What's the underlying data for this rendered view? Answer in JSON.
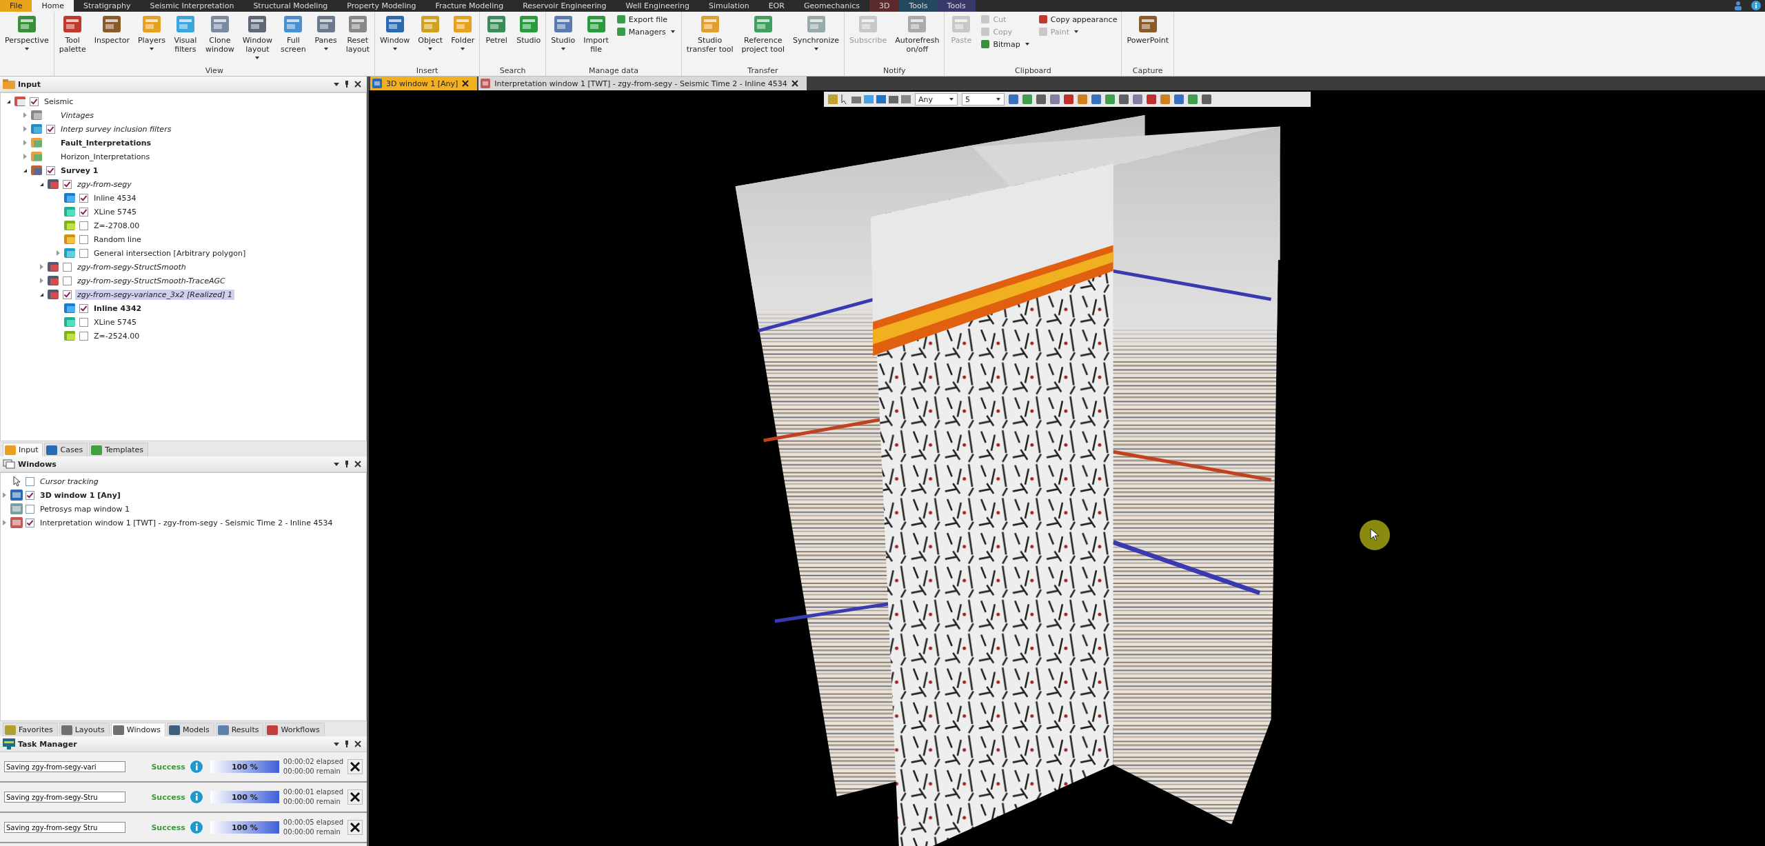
{
  "ribbon_tabs": [
    {
      "label": "File",
      "selected": false,
      "kind": "file"
    },
    {
      "label": "Home",
      "selected": true,
      "kind": "normal"
    },
    {
      "label": "Stratigraphy",
      "selected": false,
      "kind": "normal"
    },
    {
      "label": "Seismic Interpretation",
      "selected": false,
      "kind": "normal"
    },
    {
      "label": "Structural Modeling",
      "selected": false,
      "kind": "normal"
    },
    {
      "label": "Property Modeling",
      "selected": false,
      "kind": "normal"
    },
    {
      "label": "Fracture Modeling",
      "selected": false,
      "kind": "normal"
    },
    {
      "label": "Reservoir Engineering",
      "selected": false,
      "kind": "normal"
    },
    {
      "label": "Well Engineering",
      "selected": false,
      "kind": "normal"
    },
    {
      "label": "Simulation",
      "selected": false,
      "kind": "normal"
    },
    {
      "label": "EOR",
      "selected": false,
      "kind": "normal"
    },
    {
      "label": "Geomechanics",
      "selected": false,
      "kind": "normal"
    },
    {
      "label": "3D",
      "selected": false,
      "kind": "context",
      "color": "#5b2b2b"
    },
    {
      "label": "Tools",
      "selected": false,
      "kind": "context",
      "color": "#22495e"
    },
    {
      "label": "Tools",
      "selected": false,
      "kind": "context",
      "color": "#38386a"
    }
  ],
  "ribbon_groups": [
    {
      "items": [
        {
          "kind": "large",
          "label": "Perspective",
          "dropdown": true,
          "disabled": false
        }
      ]
    },
    {
      "label": "View",
      "items": [
        {
          "kind": "large",
          "label": "Tool\npalette",
          "dropdown": false,
          "disabled": false
        },
        {
          "kind": "large",
          "label": "Inspector",
          "dropdown": false,
          "disabled": false
        },
        {
          "kind": "large",
          "label": "Players",
          "dropdown": true,
          "disabled": false
        },
        {
          "kind": "large",
          "label": "Visual\nfilters",
          "dropdown": false,
          "disabled": false
        },
        {
          "kind": "large",
          "label": "Clone\nwindow",
          "dropdown": false,
          "disabled": false
        },
        {
          "kind": "large",
          "label": "Window\nlayout",
          "dropdown": true,
          "disabled": false
        },
        {
          "kind": "large",
          "label": "Full\nscreen",
          "dropdown": false,
          "disabled": false
        },
        {
          "kind": "large",
          "label": "Panes",
          "dropdown": true,
          "disabled": false
        },
        {
          "kind": "large",
          "label": "Reset\nlayout",
          "dropdown": false,
          "disabled": false
        }
      ]
    },
    {
      "label": "Insert",
      "items": [
        {
          "kind": "large",
          "label": "Window",
          "dropdown": true,
          "disabled": false
        },
        {
          "kind": "large",
          "label": "Object",
          "dropdown": true,
          "disabled": false
        },
        {
          "kind": "large",
          "label": "Folder",
          "dropdown": true,
          "disabled": false
        }
      ]
    },
    {
      "label": "Search",
      "items": [
        {
          "kind": "large",
          "label": "Petrel",
          "dropdown": false,
          "disabled": false
        },
        {
          "kind": "large",
          "label": "Studio",
          "dropdown": false,
          "disabled": false
        }
      ]
    },
    {
      "label": "Manage data",
      "items": [
        {
          "kind": "large",
          "label": "Studio",
          "dropdown": true,
          "disabled": false
        },
        {
          "kind": "large",
          "label": "Import\nfile",
          "dropdown": false,
          "disabled": false
        },
        {
          "kind": "stack",
          "items": [
            {
              "label": "Export file",
              "dropdown": false,
              "disabled": false
            },
            {
              "label": "Managers",
              "dropdown": true,
              "disabled": false
            }
          ]
        }
      ]
    },
    {
      "label": "Transfer",
      "items": [
        {
          "kind": "large",
          "label": "Studio\ntransfer tool",
          "dropdown": false,
          "disabled": false
        },
        {
          "kind": "large",
          "label": "Reference\nproject tool",
          "dropdown": false,
          "disabled": false
        },
        {
          "kind": "large",
          "label": "Synchronize",
          "dropdown": true,
          "disabled": false
        }
      ]
    },
    {
      "label": "Notify",
      "items": [
        {
          "kind": "large",
          "label": "Subscribe",
          "dropdown": false,
          "disabled": true
        },
        {
          "kind": "large",
          "label": "Autorefresh\non/off",
          "dropdown": false,
          "disabled": false
        }
      ]
    },
    {
      "label": "Clipboard",
      "items": [
        {
          "kind": "large",
          "label": "Paste",
          "dropdown": false,
          "disabled": true
        },
        {
          "kind": "stack",
          "items": [
            {
              "label": "Cut",
              "dropdown": false,
              "disabled": true
            },
            {
              "label": "Copy",
              "dropdown": false,
              "disabled": true
            },
            {
              "label": "Bitmap",
              "dropdown": true,
              "disabled": false
            }
          ]
        },
        {
          "kind": "stack",
          "items": [
            {
              "label": "Copy appearance",
              "dropdown": false,
              "disabled": false
            },
            {
              "label": "Paint",
              "dropdown": true,
              "disabled": true
            }
          ]
        }
      ]
    },
    {
      "label": "Capture",
      "items": [
        {
          "kind": "large",
          "label": "PowerPoint",
          "dropdown": false,
          "disabled": false
        }
      ]
    }
  ],
  "input_panel": {
    "title": "Input",
    "tree": [
      {
        "label": "Seismic",
        "kind": "seismicfolder",
        "checked": true,
        "expanded": true,
        "selected": false,
        "bold": false,
        "italic": false,
        "children": [
          {
            "label": "Vintages",
            "kind": "vintages",
            "expanded": false,
            "selected": false,
            "bold": false,
            "italic": true
          },
          {
            "label": "Interp survey inclusion filters",
            "kind": "filter",
            "checked": true,
            "expanded": false,
            "selected": false,
            "bold": false,
            "italic": true
          },
          {
            "label": "Fault_Interpretations",
            "kind": "folder",
            "expanded": false,
            "selected": false,
            "bold": true,
            "italic": false
          },
          {
            "label": "Horizon_Interpretations",
            "kind": "folder",
            "expanded": false,
            "selected": false,
            "bold": false,
            "italic": false
          },
          {
            "label": "Survey 1",
            "kind": "survey",
            "checked": true,
            "expanded": true,
            "selected": false,
            "bold": true,
            "italic": false,
            "children": [
              {
                "label": "zgy-from-segy",
                "kind": "cube",
                "checked": true,
                "expanded": true,
                "selected": false,
                "bold": false,
                "italic": true,
                "children": [
                  {
                    "label": "Inline 4534",
                    "kind": "inline",
                    "checked": true,
                    "selected": false,
                    "bold": false,
                    "italic": false
                  },
                  {
                    "label": "XLine 5745",
                    "kind": "xline",
                    "checked": true,
                    "selected": false,
                    "bold": false,
                    "italic": false
                  },
                  {
                    "label": "Z=-2708.00",
                    "kind": "zslice",
                    "checked": false,
                    "selected": false,
                    "bold": false,
                    "italic": false
                  },
                  {
                    "label": "Random line",
                    "kind": "randomline",
                    "checked": false,
                    "selected": false,
                    "bold": false,
                    "italic": false
                  },
                  {
                    "label": "General intersection [Arbitrary polygon]",
                    "kind": "intersection",
                    "checked": false,
                    "expanded": false,
                    "selected": false,
                    "bold": false,
                    "italic": false
                  }
                ]
              },
              {
                "label": "zgy-from-segy-StructSmooth",
                "kind": "cube",
                "checked": false,
                "expanded": false,
                "selected": false,
                "bold": false,
                "italic": true
              },
              {
                "label": "zgy-from-segy-StructSmooth-TraceAGC",
                "kind": "cube",
                "checked": false,
                "expanded": false,
                "selected": false,
                "bold": false,
                "italic": true
              },
              {
                "label": "zgy-from-segy-variance_3x2 [Realized] 1",
                "kind": "cube",
                "checked": true,
                "expanded": true,
                "selected": true,
                "bold": false,
                "italic": true,
                "children": [
                  {
                    "label": "Inline 4342",
                    "kind": "inline",
                    "checked": true,
                    "selected": false,
                    "bold": true,
                    "italic": false
                  },
                  {
                    "label": "XLine 5745",
                    "kind": "xline",
                    "checked": false,
                    "selected": false,
                    "bold": false,
                    "italic": false
                  },
                  {
                    "label": "Z=-2524.00",
                    "kind": "zslice",
                    "checked": false,
                    "selected": false,
                    "bold": false,
                    "italic": false
                  }
                ]
              }
            ]
          }
        ]
      }
    ]
  },
  "upper_tabs": [
    {
      "label": "Input",
      "selected": true
    },
    {
      "label": "Cases",
      "selected": false
    },
    {
      "label": "Templates",
      "selected": false
    }
  ],
  "windows_panel": {
    "title": "Windows",
    "items": [
      {
        "label": "Cursor tracking",
        "kind": "cursor",
        "checked": false,
        "bold": false,
        "italic": true
      },
      {
        "label": "3D window 1 [Any]",
        "kind": "scene",
        "checked": true,
        "expanded": false,
        "bold": true,
        "italic": false
      },
      {
        "label": "Petrosys map window 1",
        "kind": "map",
        "checked": false,
        "bold": false,
        "italic": false
      },
      {
        "label": "Interpretation window 1 [TWT] - zgy-from-segy - Seismic Time 2 - Inline 4534",
        "kind": "interpretation",
        "checked": true,
        "expanded": false,
        "bold": false,
        "italic": false
      }
    ]
  },
  "lower_tabs": [
    {
      "label": "Favorites",
      "selected": false
    },
    {
      "label": "Layouts",
      "selected": false
    },
    {
      "label": "Windows",
      "selected": true
    },
    {
      "label": "Models",
      "selected": false
    },
    {
      "label": "Results",
      "selected": false
    },
    {
      "label": "Workflows",
      "selected": false
    }
  ],
  "task_manager": {
    "title": "Task Manager",
    "tasks": [
      {
        "name": "Saving zgy-from-segy-vari",
        "status": "Success",
        "level": 1,
        "reading": "100 %",
        "elapsed": "00:00:02 elapsed",
        "remain": "00:00:00 remain"
      },
      {
        "name": "Saving zgy-from-segy-Stru",
        "status": "Success",
        "level": 1,
        "reading": "100 %",
        "elapsed": "00:00:01 elapsed",
        "remain": "00:00:00 remain"
      },
      {
        "name": "Saving zgy-from-segy Stru",
        "status": "Success",
        "level": 1,
        "reading": "100 %",
        "elapsed": "00:00:05 elapsed",
        "remain": "00:00:00 remain"
      }
    ]
  },
  "document_tabs": [
    {
      "label": "3D window 1 [Any]",
      "kind": "scene",
      "selected": true
    },
    {
      "label": "Interpretation window 1 [TWT] - zgy-from-segy - Seismic Time 2 - Inline 4534",
      "kind": "interpretation",
      "selected": false
    }
  ],
  "viewer_toolbar": {
    "combos": [
      {
        "value": "Any"
      },
      {
        "value": "5"
      }
    ]
  }
}
